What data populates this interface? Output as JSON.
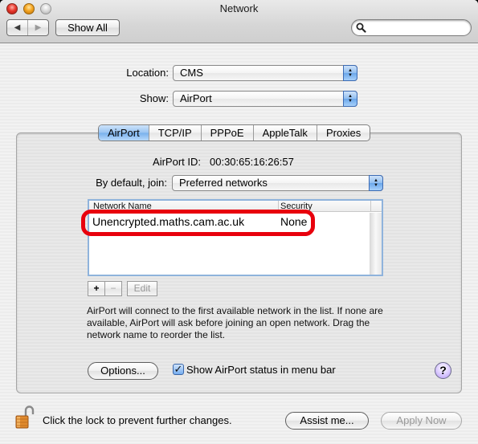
{
  "window": {
    "title": "Network",
    "traffic_lights": [
      "close",
      "minimize",
      "zoom"
    ]
  },
  "toolbar": {
    "back_icon": "◀",
    "forward_icon": "▶",
    "show_all_label": "Show All",
    "search": {
      "value": "",
      "placeholder": "",
      "icon": "magnifier-icon"
    }
  },
  "location": {
    "label": "Location:",
    "value": "CMS"
  },
  "show": {
    "label": "Show:",
    "value": "AirPort"
  },
  "tabs": [
    {
      "label": "AirPort",
      "active": true
    },
    {
      "label": "TCP/IP",
      "active": false
    },
    {
      "label": "PPPoE",
      "active": false
    },
    {
      "label": "AppleTalk",
      "active": false
    },
    {
      "label": "Proxies",
      "active": false
    }
  ],
  "airport": {
    "id_label": "AirPort ID:",
    "id_value": "00:30:65:16:26:57",
    "join_label": "By default, join:",
    "join_value": "Preferred networks",
    "list": {
      "columns": [
        "Network Name",
        "Security"
      ],
      "rows": [
        {
          "name": "Unencrypted.maths.cam.ac.uk",
          "security": "None",
          "highlighted": true
        }
      ],
      "highlight_color": "#e8000d"
    },
    "add_label": "+",
    "remove_label": "−",
    "edit_label": "Edit",
    "description": "AirPort will connect to the first available network in the list. If none are available, AirPort will ask before joining an open network. Drag the network name to reorder the list.",
    "options_label": "Options...",
    "show_status_label": "Show AirPort status in menu bar",
    "show_status_checked": true,
    "help_label": "?"
  },
  "footer": {
    "lock_text": "Click the lock to prevent further changes.",
    "assist_label": "Assist me...",
    "apply_label": "Apply Now",
    "apply_enabled": false
  }
}
